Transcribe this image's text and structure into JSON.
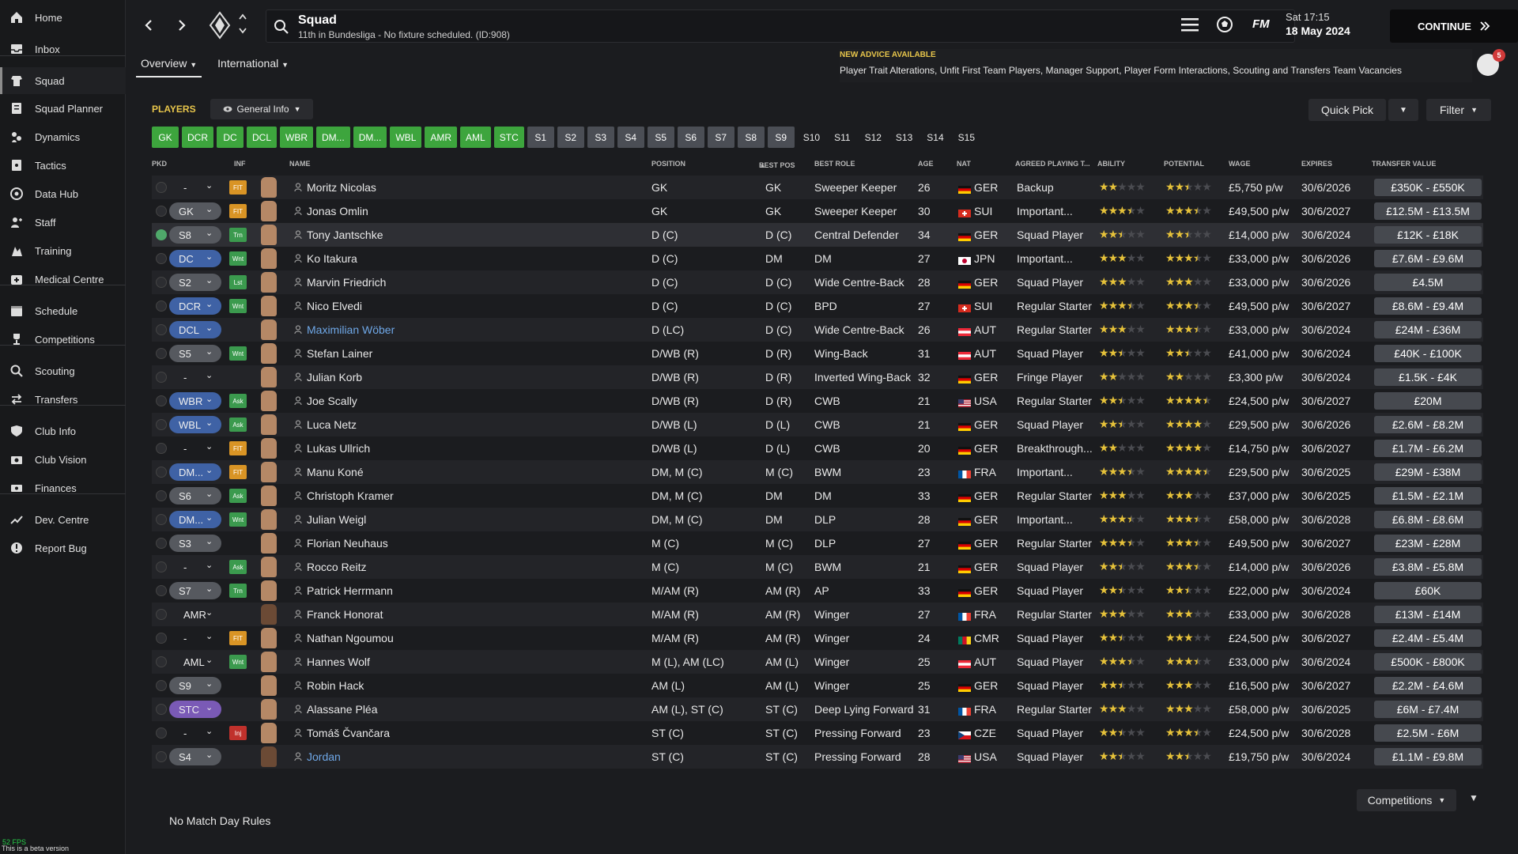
{
  "sidebar": {
    "items": [
      {
        "label": "Home",
        "icon": "home-icon"
      },
      {
        "label": "Inbox",
        "icon": "inbox-icon"
      },
      {
        "label": "Squad",
        "icon": "squad-icon"
      },
      {
        "label": "Squad Planner",
        "icon": "planner-icon"
      },
      {
        "label": "Dynamics",
        "icon": "dynamics-icon"
      },
      {
        "label": "Tactics",
        "icon": "tactics-icon"
      },
      {
        "label": "Data Hub",
        "icon": "data-hub-icon"
      },
      {
        "label": "Staff",
        "icon": "staff-icon"
      },
      {
        "label": "Training",
        "icon": "training-icon"
      },
      {
        "label": "Medical Centre",
        "icon": "medical-icon"
      },
      {
        "label": "Schedule",
        "icon": "schedule-icon"
      },
      {
        "label": "Competitions",
        "icon": "trophy-icon"
      },
      {
        "label": "Scouting",
        "icon": "scouting-icon"
      },
      {
        "label": "Transfers",
        "icon": "transfers-icon"
      },
      {
        "label": "Club Info",
        "icon": "club-info-icon"
      },
      {
        "label": "Club Vision",
        "icon": "club-vision-icon"
      },
      {
        "label": "Finances",
        "icon": "finances-icon"
      },
      {
        "label": "Dev. Centre",
        "icon": "dev-centre-icon"
      },
      {
        "label": "Report Bug",
        "icon": "report-bug-icon"
      }
    ],
    "fps": "52 FPS",
    "beta": "This is a beta version"
  },
  "header": {
    "title": "Squad",
    "subtitle": "11th in Bundesliga - No fixture scheduled. (ID:908)",
    "logo": "FM",
    "time": "Sat 17:15",
    "date": "18 May 2024",
    "continue": "CONTINUE"
  },
  "tabs": [
    {
      "label": "Overview"
    },
    {
      "label": "International"
    }
  ],
  "advice": {
    "title": "NEW ADVICE AVAILABLE",
    "text": "Player Trait Alterations, Unfit First Team Players, Manager Support, Player Form Interactions, Scouting and Transfers Team Vacancies",
    "badge": "5"
  },
  "toolbar": {
    "players_label": "PLAYERS",
    "view": "General Info",
    "quick_pick": "Quick Pick",
    "filter": "Filter"
  },
  "chips": [
    {
      "label": "GK",
      "style": "green"
    },
    {
      "label": "DCR",
      "style": "green"
    },
    {
      "label": "DC",
      "style": "green"
    },
    {
      "label": "DCL",
      "style": "green"
    },
    {
      "label": "WBR",
      "style": "green"
    },
    {
      "label": "DM...",
      "style": "green"
    },
    {
      "label": "DM...",
      "style": "green"
    },
    {
      "label": "WBL",
      "style": "green"
    },
    {
      "label": "AMR",
      "style": "green"
    },
    {
      "label": "AML",
      "style": "green"
    },
    {
      "label": "STC",
      "style": "green"
    },
    {
      "label": "S1",
      "style": "grey"
    },
    {
      "label": "S2",
      "style": "grey"
    },
    {
      "label": "S3",
      "style": "grey"
    },
    {
      "label": "S4",
      "style": "grey"
    },
    {
      "label": "S5",
      "style": "grey"
    },
    {
      "label": "S6",
      "style": "grey"
    },
    {
      "label": "S7",
      "style": "grey"
    },
    {
      "label": "S8",
      "style": "grey"
    },
    {
      "label": "S9",
      "style": "grey"
    },
    {
      "label": "S10",
      "style": "plain"
    },
    {
      "label": "S11",
      "style": "plain"
    },
    {
      "label": "S12",
      "style": "plain"
    },
    {
      "label": "S13",
      "style": "plain"
    },
    {
      "label": "S14",
      "style": "plain"
    },
    {
      "label": "S15",
      "style": "plain"
    }
  ],
  "columns": {
    "pkd": "PKD",
    "inf": "INF",
    "name": "NAME",
    "position": "POSITION",
    "best_pos": "BEST POS",
    "best_role": "BEST ROLE",
    "age": "AGE",
    "nat": "NAT",
    "apt": "AGREED PLAYING T...",
    "ability": "ABILITY",
    "potential": "POTENTIAL",
    "wage": "WAGE",
    "expires": "EXPIRES",
    "transfer_value": "TRANSFER VALUE"
  },
  "players": [
    {
      "pkd": "-",
      "pkd_style": "blank",
      "inf": "FIT",
      "name": "Moritz Nicolas",
      "position": "GK",
      "best_pos": "GK",
      "role": "Sweeper Keeper",
      "age": "26",
      "flag": "de",
      "nat": "GER",
      "apt": "Backup",
      "ability": 2,
      "potential": 2.5,
      "wage": "£5,750 p/w",
      "expires": "30/6/2026",
      "tv": "£350K - £550K"
    },
    {
      "pkd": "GK",
      "pkd_style": "grey",
      "inf": "FIT",
      "name": "Jonas Omlin",
      "position": "GK",
      "best_pos": "GK",
      "role": "Sweeper Keeper",
      "age": "30",
      "flag": "ch",
      "nat": "SUI",
      "apt": "Important...",
      "ability": 3.5,
      "potential": 3.5,
      "wage": "£49,500 p/w",
      "expires": "30/6/2027",
      "tv": "£12.5M - £13.5M"
    },
    {
      "pkd": "S8",
      "pkd_style": "grey",
      "inf": "Trn",
      "name": "Tony Jantschke",
      "position": "D (C)",
      "best_pos": "D (C)",
      "role": "Central Defender",
      "age": "34",
      "flag": "de",
      "nat": "GER",
      "apt": "Squad Player",
      "ability": 2.5,
      "potential": 2.5,
      "wage": "£14,000 p/w",
      "expires": "30/6/2024",
      "tv": "£12K - £18K",
      "checked": true
    },
    {
      "pkd": "DC",
      "pkd_style": "blue",
      "inf": "Wnt",
      "name": "Ko Itakura",
      "position": "D (C)",
      "best_pos": "DM",
      "role": "DM",
      "age": "27",
      "flag": "jp",
      "nat": "JPN",
      "apt": "Important...",
      "ability": 3,
      "potential": 3.5,
      "wage": "£33,000 p/w",
      "expires": "30/6/2026",
      "tv": "£7.6M - £9.6M"
    },
    {
      "pkd": "S2",
      "pkd_style": "grey",
      "inf": "Lst",
      "name": "Marvin Friedrich",
      "position": "D (C)",
      "best_pos": "D (C)",
      "role": "Wide Centre-Back",
      "age": "28",
      "flag": "de",
      "nat": "GER",
      "apt": "Squad Player",
      "ability": 3,
      "potential": 3,
      "wage": "£33,000 p/w",
      "expires": "30/6/2026",
      "tv": "£4.5M"
    },
    {
      "pkd": "DCR",
      "pkd_style": "blue",
      "inf": "Wnt",
      "name": "Nico Elvedi",
      "position": "D (C)",
      "best_pos": "D (C)",
      "role": "BPD",
      "age": "27",
      "flag": "ch",
      "nat": "SUI",
      "apt": "Regular Starter",
      "ability": 3.5,
      "potential": 3.5,
      "wage": "£49,500 p/w",
      "expires": "30/6/2027",
      "tv": "£8.6M - £9.4M"
    },
    {
      "pkd": "DCL",
      "pkd_style": "blue",
      "inf": "",
      "name": "Maximilian Wöber",
      "link": true,
      "position": "D (LC)",
      "best_pos": "D (C)",
      "role": "Wide Centre-Back",
      "age": "26",
      "flag": "at",
      "nat": "AUT",
      "apt": "Regular Starter",
      "ability": 3,
      "potential": 3.5,
      "wage": "£33,000 p/w",
      "expires": "30/6/2024",
      "tv": "£24M - £36M"
    },
    {
      "pkd": "S5",
      "pkd_style": "grey",
      "inf": "Wnt",
      "name": "Stefan Lainer",
      "position": "D/WB (R)",
      "best_pos": "D (R)",
      "role": "Wing-Back",
      "age": "31",
      "flag": "at",
      "nat": "AUT",
      "apt": "Squad Player",
      "ability": 2.5,
      "potential": 2.5,
      "wage": "£41,000 p/w",
      "expires": "30/6/2024",
      "tv": "£40K - £100K"
    },
    {
      "pkd": "-",
      "pkd_style": "blank",
      "inf": "",
      "name": "Julian Korb",
      "position": "D/WB (R)",
      "best_pos": "D (R)",
      "role": "Inverted Wing-Back",
      "age": "32",
      "flag": "de",
      "nat": "GER",
      "apt": "Fringe Player",
      "ability": 2,
      "potential": 2,
      "wage": "£3,300 p/w",
      "expires": "30/6/2024",
      "tv": "£1.5K - £4K"
    },
    {
      "pkd": "WBR",
      "pkd_style": "blue",
      "inf": "Ask",
      "name": "Joe Scally",
      "position": "D/WB (R)",
      "best_pos": "D (R)",
      "role": "CWB",
      "age": "21",
      "flag": "us",
      "nat": "USA",
      "apt": "Regular Starter",
      "ability": 2.5,
      "potential": 4.5,
      "wage": "£24,500 p/w",
      "expires": "30/6/2027",
      "tv": "£20M"
    },
    {
      "pkd": "WBL",
      "pkd_style": "blue",
      "inf": "Ask",
      "name": "Luca Netz",
      "position": "D/WB (L)",
      "best_pos": "D (L)",
      "role": "CWB",
      "age": "21",
      "flag": "de",
      "nat": "GER",
      "apt": "Squad Player",
      "ability": 2.5,
      "potential": 4,
      "wage": "£29,500 p/w",
      "expires": "30/6/2026",
      "tv": "£2.6M - £8.2M"
    },
    {
      "pkd": "-",
      "pkd_style": "blank",
      "inf": "FIT",
      "name": "Lukas Ullrich",
      "position": "D/WB (L)",
      "best_pos": "D (L)",
      "role": "CWB",
      "age": "20",
      "flag": "de",
      "nat": "GER",
      "apt": "Breakthrough...",
      "ability": 2,
      "potential": 4,
      "wage": "£14,750 p/w",
      "expires": "30/6/2027",
      "tv": "£1.7M - £6.2M"
    },
    {
      "pkd": "DM...",
      "pkd_style": "blue",
      "inf": "FIT",
      "name": "Manu Koné",
      "position": "DM, M (C)",
      "best_pos": "M (C)",
      "role": "BWM",
      "age": "23",
      "flag": "fr",
      "nat": "FRA",
      "apt": "Important...",
      "ability": 3.5,
      "potential": 4.5,
      "wage": "£29,500 p/w",
      "expires": "30/6/2025",
      "tv": "£29M - £38M"
    },
    {
      "pkd": "S6",
      "pkd_style": "grey",
      "inf": "Ask",
      "name": "Christoph Kramer",
      "position": "DM, M (C)",
      "best_pos": "DM",
      "role": "DM",
      "age": "33",
      "flag": "de",
      "nat": "GER",
      "apt": "Regular Starter",
      "ability": 3,
      "potential": 3,
      "wage": "£37,000 p/w",
      "expires": "30/6/2025",
      "tv": "£1.5M - £2.1M"
    },
    {
      "pkd": "DM...",
      "pkd_style": "blue",
      "inf": "Wnt",
      "name": "Julian Weigl",
      "position": "DM, M (C)",
      "best_pos": "DM",
      "role": "DLP",
      "age": "28",
      "flag": "de",
      "nat": "GER",
      "apt": "Important...",
      "ability": 3.5,
      "potential": 3.5,
      "wage": "£58,000 p/w",
      "expires": "30/6/2028",
      "tv": "£6.8M - £8.6M"
    },
    {
      "pkd": "S3",
      "pkd_style": "grey",
      "inf": "",
      "name": "Florian Neuhaus",
      "position": "M (C)",
      "best_pos": "M (C)",
      "role": "DLP",
      "age": "27",
      "flag": "de",
      "nat": "GER",
      "apt": "Regular Starter",
      "ability": 3.5,
      "potential": 3.5,
      "wage": "£49,500 p/w",
      "expires": "30/6/2027",
      "tv": "£23M - £28M"
    },
    {
      "pkd": "-",
      "pkd_style": "blank",
      "inf": "Ask",
      "name": "Rocco Reitz",
      "position": "M (C)",
      "best_pos": "M (C)",
      "role": "BWM",
      "age": "21",
      "flag": "de",
      "nat": "GER",
      "apt": "Squad Player",
      "ability": 2.5,
      "potential": 3.5,
      "wage": "£14,000 p/w",
      "expires": "30/6/2026",
      "tv": "£3.8M - £5.8M"
    },
    {
      "pkd": "S7",
      "pkd_style": "grey",
      "inf": "Trn",
      "name": "Patrick Herrmann",
      "position": "M/AM (R)",
      "best_pos": "AM (R)",
      "role": "AP",
      "age": "33",
      "flag": "de",
      "nat": "GER",
      "apt": "Squad Player",
      "ability": 2.5,
      "potential": 2.5,
      "wage": "£22,000 p/w",
      "expires": "30/6/2024",
      "tv": "£60K"
    },
    {
      "pkd": "AMR",
      "pkd_style": "blank",
      "inf": "",
      "name": "Franck Honorat",
      "position": "M/AM (R)",
      "best_pos": "AM (R)",
      "role": "Winger",
      "age": "27",
      "flag": "fr",
      "nat": "FRA",
      "apt": "Regular Starter",
      "ability": 3,
      "potential": 3,
      "wage": "£33,000 p/w",
      "expires": "30/6/2028",
      "tv": "£13M - £14M",
      "dark": true
    },
    {
      "pkd": "-",
      "pkd_style": "blank",
      "inf": "FIT",
      "name": "Nathan Ngoumou",
      "position": "M/AM (R)",
      "best_pos": "AM (R)",
      "role": "Winger",
      "age": "24",
      "flag": "cm",
      "nat": "CMR",
      "apt": "Squad Player",
      "ability": 2.5,
      "potential": 3,
      "wage": "£24,500 p/w",
      "expires": "30/6/2027",
      "tv": "£2.4M - £5.4M"
    },
    {
      "pkd": "AML",
      "pkd_style": "blank",
      "inf": "Wnt",
      "name": "Hannes Wolf",
      "position": "M (L), AM (LC)",
      "best_pos": "AM (L)",
      "role": "Winger",
      "age": "25",
      "flag": "at",
      "nat": "AUT",
      "apt": "Squad Player",
      "ability": 3.5,
      "potential": 3.5,
      "wage": "£33,000 p/w",
      "expires": "30/6/2024",
      "tv": "£500K - £800K"
    },
    {
      "pkd": "S9",
      "pkd_style": "grey",
      "inf": "",
      "name": "Robin Hack",
      "position": "AM (L)",
      "best_pos": "AM (L)",
      "role": "Winger",
      "age": "25",
      "flag": "de",
      "nat": "GER",
      "apt": "Squad Player",
      "ability": 2.5,
      "potential": 3,
      "wage": "£16,500 p/w",
      "expires": "30/6/2027",
      "tv": "£2.2M - £4.6M"
    },
    {
      "pkd": "STC",
      "pkd_style": "purple",
      "inf": "",
      "name": "Alassane Pléa",
      "position": "AM (L), ST (C)",
      "best_pos": "ST (C)",
      "role": "Deep Lying Forward",
      "age": "31",
      "flag": "fr",
      "nat": "FRA",
      "apt": "Regular Starter",
      "ability": 3,
      "potential": 3,
      "wage": "£58,000 p/w",
      "expires": "30/6/2025",
      "tv": "£6M - £7.4M"
    },
    {
      "pkd": "-",
      "pkd_style": "blank",
      "inf": "Inj",
      "name": "Tomáš Čvančara",
      "position": "ST (C)",
      "best_pos": "ST (C)",
      "role": "Pressing Forward",
      "age": "23",
      "flag": "cz",
      "nat": "CZE",
      "apt": "Squad Player",
      "ability": 2.5,
      "potential": 3.5,
      "wage": "£24,500 p/w",
      "expires": "30/6/2028",
      "tv": "£2.5M - £6M"
    },
    {
      "pkd": "S4",
      "pkd_style": "grey",
      "inf": "",
      "name": "Jordan",
      "link": true,
      "position": "ST (C)",
      "best_pos": "ST (C)",
      "role": "Pressing Forward",
      "age": "28",
      "flag": "us",
      "nat": "USA",
      "apt": "Squad Player",
      "ability": 2.5,
      "potential": 2.5,
      "wage": "£19,750 p/w",
      "expires": "30/6/2024",
      "tv": "£1.1M - £9.8M",
      "dark": true
    }
  ],
  "footer": {
    "no_rules": "No Match Day Rules",
    "competitions": "Competitions"
  },
  "colors": {
    "accent_yellow": "#e8c64b",
    "chip_green": "#3da53d",
    "star": "#e6c23a",
    "link": "#6fa8e8"
  }
}
